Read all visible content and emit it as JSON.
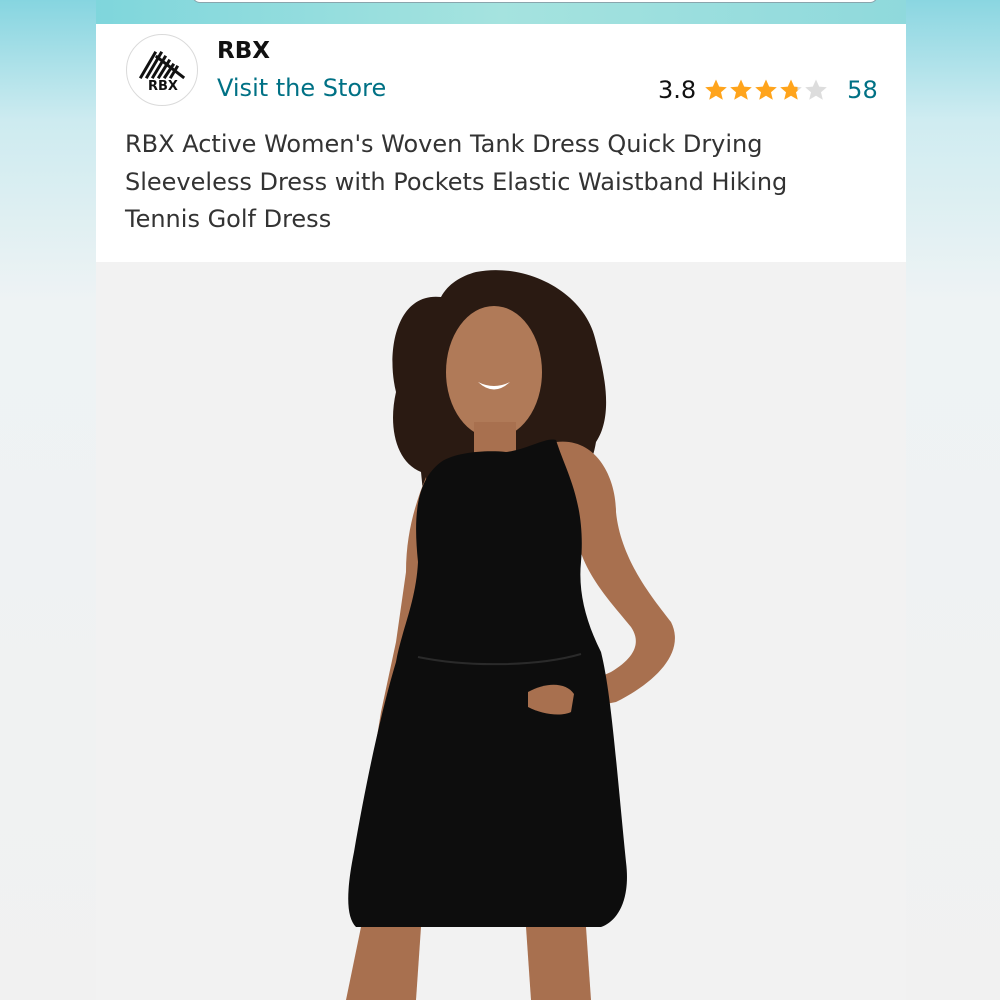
{
  "brand": {
    "logo_text": "RBX",
    "name": "RBX",
    "visit_store_label": "Visit the Store"
  },
  "rating": {
    "value": "3.8",
    "stars_out_of_5": 3.8,
    "count": "58",
    "star_color": "#ffa41c"
  },
  "product": {
    "title": "RBX Active Women's Woven Tank Dress Quick Drying Sleeveless Dress with Pockets Elastic Waistband Hiking Tennis Golf Dress"
  },
  "colors": {
    "link": "#007185",
    "accent_strip": "#8fd9dc"
  }
}
